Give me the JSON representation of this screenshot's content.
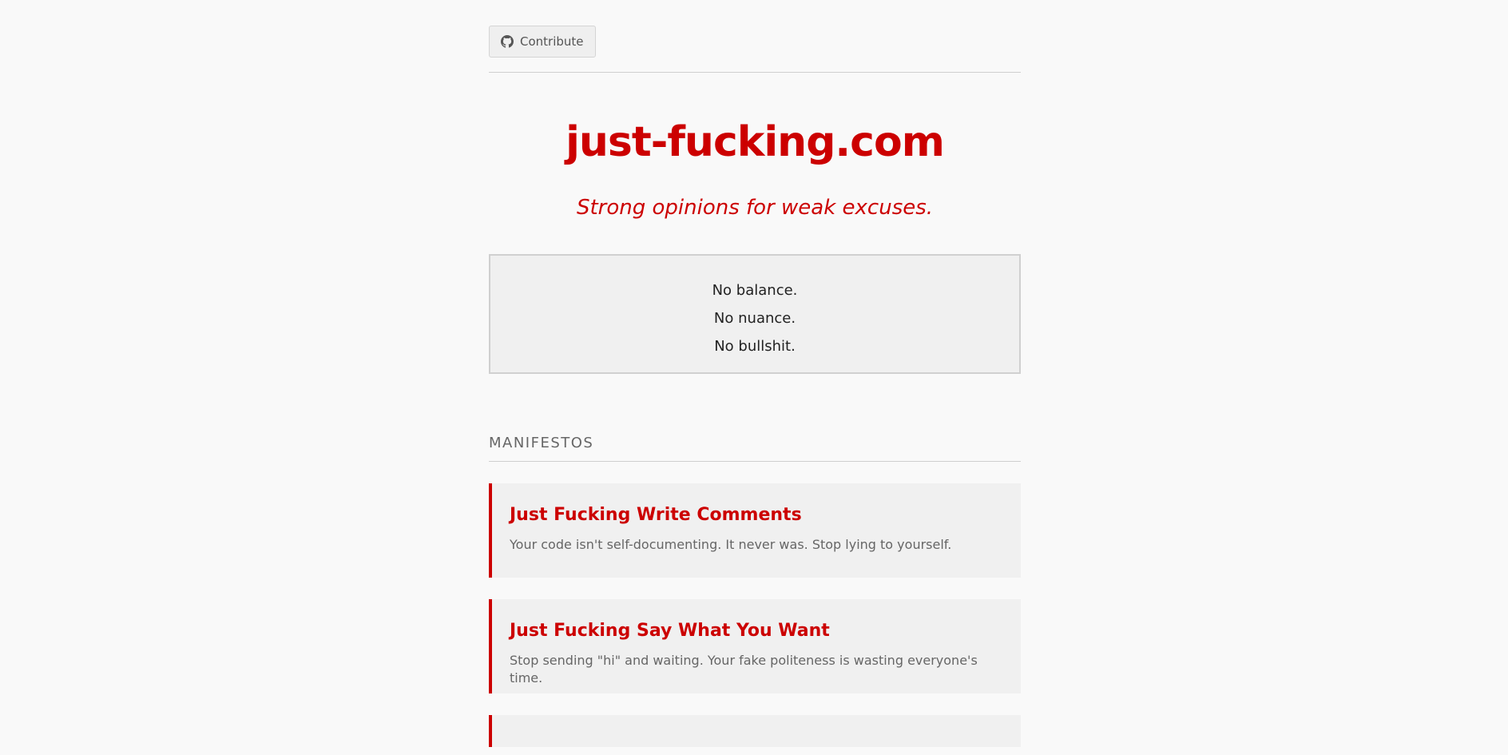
{
  "header": {
    "contribute_label": "Contribute"
  },
  "hero": {
    "title": "just-fucking.com",
    "tagline": "Strong opinions for weak excuses."
  },
  "principles": [
    "No balance.",
    "No nuance.",
    "No bullshit."
  ],
  "manifestos": {
    "heading": "MANIFESTOS",
    "items": [
      {
        "title": "Just Fucking Write Comments",
        "description": "Your code isn't self-documenting. It never was. Stop lying to yourself."
      },
      {
        "title": "Just Fucking Say What You Want",
        "description": "Stop sending \"hi\" and waiting. Your fake politeness is wasting everyone's time."
      }
    ]
  },
  "colors": {
    "accent": "#cc0000",
    "background": "#f9f9f9",
    "card": "#f0f0f0"
  },
  "icons": {
    "contribute": "github-icon"
  }
}
